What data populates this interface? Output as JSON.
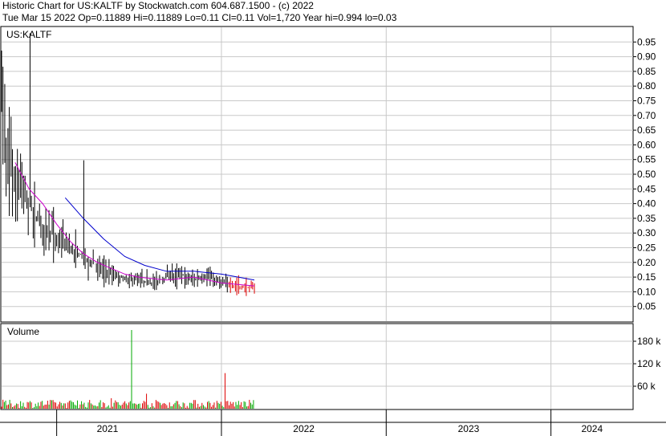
{
  "header": {
    "line1": "Historic Chart for US:KALTF by Stockwatch.com 604.687.1500 - (c) 2022",
    "line2": "Tue Mar 15 2022   Op=0.11889   Hi=0.11889   Lo=0.11   Cl=0.11   Vol=1,720   Year hi=0.994   lo=0.03"
  },
  "chart_data": [
    {
      "type": "ohlc",
      "title": "US:KALTF",
      "y_ticks": [
        "0.95",
        "0.90",
        "0.85",
        "0.80",
        "0.75",
        "0.70",
        "0.65",
        "0.60",
        "0.55",
        "0.50",
        "0.45",
        "0.40",
        "0.35",
        "0.30",
        "0.25",
        "0.20",
        "0.15",
        "0.10",
        "0.05"
      ],
      "ylim": [
        0,
        1.0
      ],
      "x_labels": [
        "2021",
        "2022",
        "2023",
        "2024"
      ],
      "xlim": [
        "2020-09-01",
        "2024-07-01"
      ],
      "grid": true,
      "colors": {
        "price": "#000000",
        "ma_fast": "#cc00cc",
        "ma_slow": "#0000cc",
        "recent": "#dd0000"
      },
      "price_path": [
        [
          "2020-09-01",
          0.8
        ],
        [
          "2020-09-08",
          0.6
        ],
        [
          "2020-09-15",
          0.62
        ],
        [
          "2020-09-22",
          0.55
        ],
        [
          "2020-10-01",
          0.5
        ],
        [
          "2020-10-10",
          0.47
        ],
        [
          "2020-10-20",
          0.44
        ],
        [
          "2020-11-01",
          0.4
        ],
        [
          "2020-11-15",
          0.36
        ],
        [
          "2020-12-01",
          0.33
        ],
        [
          "2020-12-15",
          0.31
        ],
        [
          "2021-01-01",
          0.28
        ],
        [
          "2021-01-20",
          0.26
        ],
        [
          "2021-02-10",
          0.24
        ],
        [
          "2021-03-01",
          0.22
        ],
        [
          "2021-03-20",
          0.2
        ],
        [
          "2021-04-10",
          0.18
        ],
        [
          "2021-05-01",
          0.16
        ],
        [
          "2021-05-20",
          0.15
        ],
        [
          "2021-06-10",
          0.14
        ],
        [
          "2021-07-01",
          0.14
        ],
        [
          "2021-08-01",
          0.13
        ],
        [
          "2021-09-01",
          0.15
        ],
        [
          "2021-10-01",
          0.16
        ],
        [
          "2021-11-01",
          0.14
        ],
        [
          "2021-12-01",
          0.15
        ],
        [
          "2022-01-01",
          0.13
        ],
        [
          "2022-02-01",
          0.12
        ],
        [
          "2022-03-15",
          0.11
        ]
      ],
      "ma_fast": [
        [
          "2020-10-01",
          0.54
        ],
        [
          "2020-11-01",
          0.45
        ],
        [
          "2020-12-01",
          0.4
        ],
        [
          "2021-01-01",
          0.33
        ],
        [
          "2021-02-01",
          0.27
        ],
        [
          "2021-03-01",
          0.23
        ],
        [
          "2021-04-01",
          0.2
        ],
        [
          "2021-05-01",
          0.18
        ],
        [
          "2021-06-01",
          0.16
        ],
        [
          "2021-07-01",
          0.15
        ],
        [
          "2021-09-01",
          0.14
        ],
        [
          "2021-11-01",
          0.15
        ],
        [
          "2022-01-01",
          0.13
        ],
        [
          "2022-03-15",
          0.12
        ]
      ],
      "ma_slow": [
        [
          "2021-01-20",
          0.42
        ],
        [
          "2021-03-01",
          0.35
        ],
        [
          "2021-04-15",
          0.28
        ],
        [
          "2021-06-01",
          0.22
        ],
        [
          "2021-07-15",
          0.19
        ],
        [
          "2021-09-01",
          0.17
        ],
        [
          "2021-11-01",
          0.17
        ],
        [
          "2022-01-01",
          0.16
        ],
        [
          "2022-03-15",
          0.14
        ]
      ],
      "volume": {
        "label": "Volume",
        "y_ticks": [
          "180 k",
          "120 k",
          "60 k"
        ],
        "ylim": [
          0,
          225000
        ],
        "spikes": [
          [
            "2021-06-15",
            210000
          ],
          [
            "2022-01-10",
            95000
          ],
          [
            "2021-07-20",
            40000
          ],
          [
            "2021-05-01",
            28000
          ],
          [
            "2021-02-15",
            22000
          ]
        ]
      }
    }
  ]
}
